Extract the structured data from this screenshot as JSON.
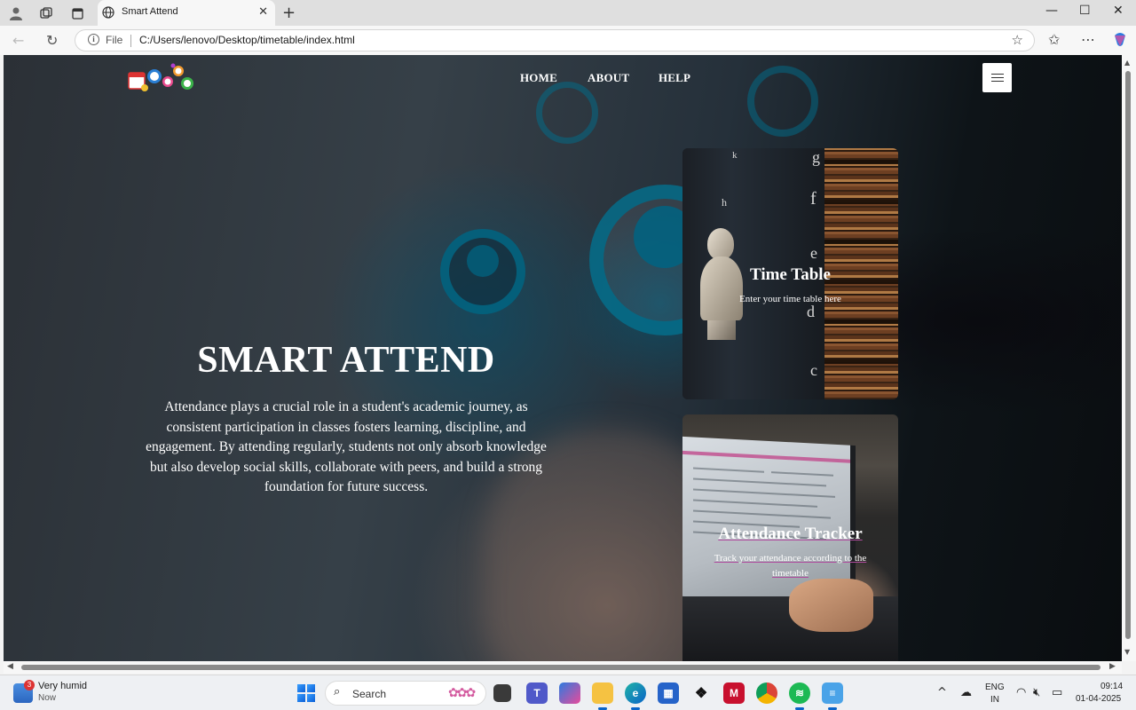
{
  "browser": {
    "tab_title": "Smart Attend",
    "url_scheme_label": "File",
    "url": "C:/Users/lenovo/Desktop/timetable/index.html",
    "icons": [
      "profile-icon",
      "collections-icon",
      "tab-actions-icon",
      "globe-icon",
      "close-icon",
      "new-tab-icon",
      "minimize-icon",
      "maximize-icon",
      "window-close-icon",
      "back-icon",
      "refresh-icon",
      "info-icon",
      "favorite-star-icon",
      "favorites-icon",
      "more-icon",
      "copilot-icon"
    ]
  },
  "page": {
    "nav": {
      "links": [
        "HOME",
        "ABOUT",
        "HELP"
      ]
    },
    "hero": {
      "title": "SMART ATTEND",
      "text": "Attendance plays a crucial role in a student's academic journey, as consistent participation in classes fosters learning, discipline, and engagement. By attending regularly, students not only absorb knowledge but also develop social skills, collaborate with peers, and build a strong foundation for future success."
    },
    "cards": [
      {
        "title": "Time Table",
        "subtitle": "Enter your time table here"
      },
      {
        "title": "Attendance Tracker",
        "subtitle": "Track your attendance according to the timetable"
      }
    ],
    "accent_underline": "#b04a9e"
  },
  "taskbar": {
    "weather": {
      "title": "Very humid",
      "subtitle": "Now",
      "badge": "3"
    },
    "search_placeholder": "Search",
    "language": {
      "line1": "ENG",
      "line2": "IN"
    },
    "clock": {
      "time": "09:14",
      "date": "01-04-2025"
    },
    "apps": [
      "start-icon",
      "task-view-icon",
      "teams-icon",
      "copilot-icon",
      "file-explorer-icon",
      "edge-icon",
      "store-icon",
      "dropbox-icon",
      "mcafee-icon",
      "chrome-icon",
      "spotify-icon",
      "notepad-icon"
    ]
  }
}
